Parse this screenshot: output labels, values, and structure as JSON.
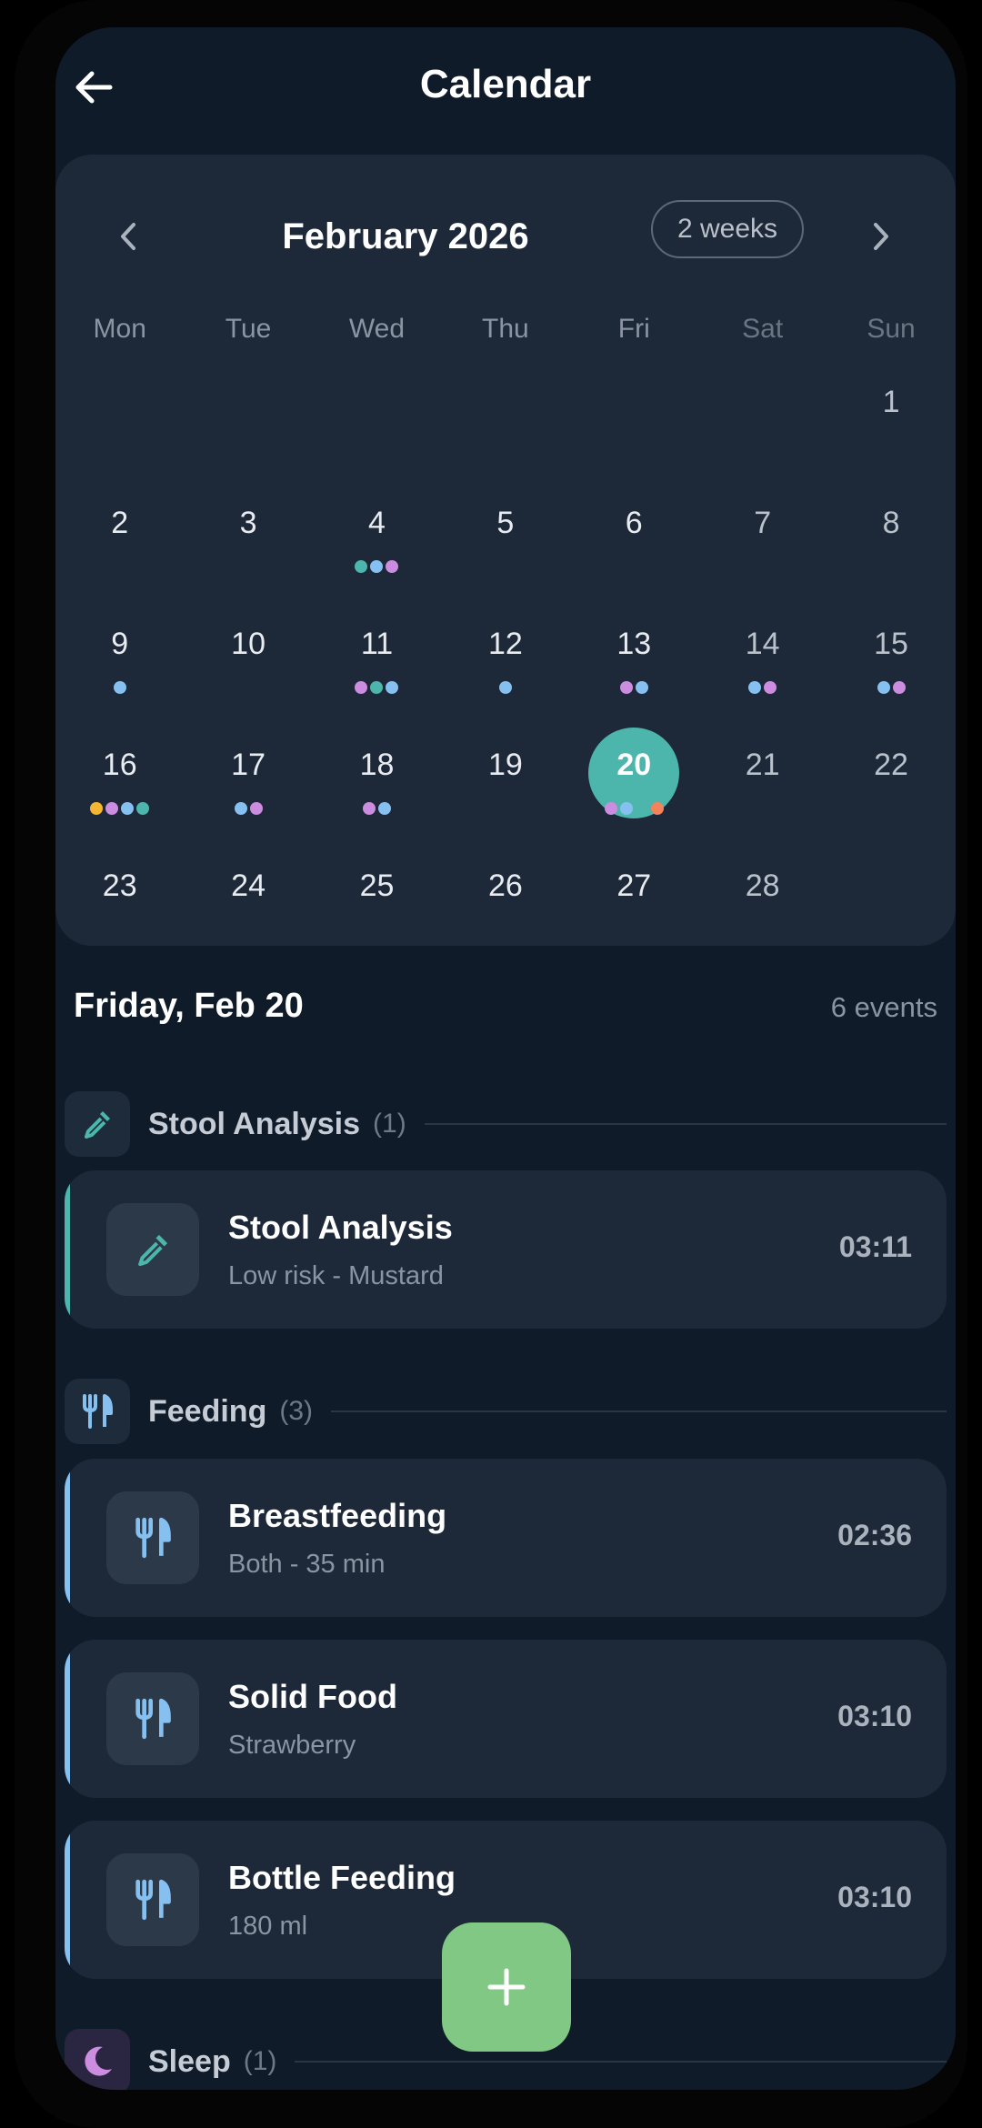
{
  "header": {
    "title": "Calendar"
  },
  "calendar": {
    "month_label": "February 2026",
    "range_label": "2 weeks",
    "weekdays": [
      "Mon",
      "Tue",
      "Wed",
      "Thu",
      "Fri",
      "Sat",
      "Sun"
    ],
    "selected_day": "20",
    "colors": {
      "green": "#4db6ac",
      "blue": "#86c0f0",
      "pink": "#cc8ce0",
      "yellow": "#f5b731",
      "orange": "#f2835a"
    },
    "weeks": [
      [
        {
          "day": ""
        },
        {
          "day": ""
        },
        {
          "day": ""
        },
        {
          "day": ""
        },
        {
          "day": ""
        },
        {
          "day": ""
        },
        {
          "day": "1"
        }
      ],
      [
        {
          "day": "2"
        },
        {
          "day": "3"
        },
        {
          "day": "4",
          "dots": [
            "green",
            "blue",
            "pink"
          ]
        },
        {
          "day": "5"
        },
        {
          "day": "6"
        },
        {
          "day": "7"
        },
        {
          "day": "8"
        }
      ],
      [
        {
          "day": "9",
          "dots": [
            "blue"
          ]
        },
        {
          "day": "10"
        },
        {
          "day": "11",
          "dots": [
            "pink",
            "green",
            "blue"
          ]
        },
        {
          "day": "12",
          "dots": [
            "blue"
          ]
        },
        {
          "day": "13",
          "dots": [
            "pink",
            "blue"
          ]
        },
        {
          "day": "14",
          "dots": [
            "blue",
            "pink"
          ]
        },
        {
          "day": "15",
          "dots": [
            "blue",
            "pink"
          ]
        }
      ],
      [
        {
          "day": "16",
          "dots": [
            "yellow",
            "pink",
            "blue",
            "green"
          ]
        },
        {
          "day": "17",
          "dots": [
            "blue",
            "pink"
          ]
        },
        {
          "day": "18",
          "dots": [
            "pink",
            "blue"
          ]
        },
        {
          "day": "19"
        },
        {
          "day": "20",
          "dots": [
            "pink",
            "blue",
            "green",
            "orange"
          ]
        },
        {
          "day": "21"
        },
        {
          "day": "22"
        }
      ],
      [
        {
          "day": "23"
        },
        {
          "day": "24"
        },
        {
          "day": "25"
        },
        {
          "day": "26"
        },
        {
          "day": "27"
        },
        {
          "day": "28"
        },
        {
          "day": ""
        }
      ]
    ]
  },
  "day_view": {
    "date_title": "Friday, Feb 20",
    "event_count": "6 events",
    "sections": {
      "stool": {
        "label": "Stool Analysis",
        "count": "(1)",
        "icon": "dropper-icon",
        "color": "#4db6ac"
      },
      "feeding": {
        "label": "Feeding",
        "count": "(3)",
        "icon": "utensils-icon",
        "color": "#86c0f0"
      },
      "sleep": {
        "label": "Sleep",
        "count": "(1)",
        "icon": "moon-icon",
        "color": "#cc8ce0"
      }
    },
    "events": {
      "stool_analysis": {
        "title": "Stool Analysis",
        "subtitle": "Low risk - Mustard",
        "time": "03:11"
      },
      "breastfeeding": {
        "title": "Breastfeeding",
        "subtitle": "Both - 35 min",
        "time": "02:36"
      },
      "solid_food": {
        "title": "Solid Food",
        "subtitle": "Strawberry",
        "time": "03:10"
      },
      "bottle_feeding": {
        "title": "Bottle Feeding",
        "subtitle": "180 ml",
        "time": "03:10"
      }
    }
  },
  "fab": {
    "icon": "plus-icon",
    "color": "#80c883"
  }
}
